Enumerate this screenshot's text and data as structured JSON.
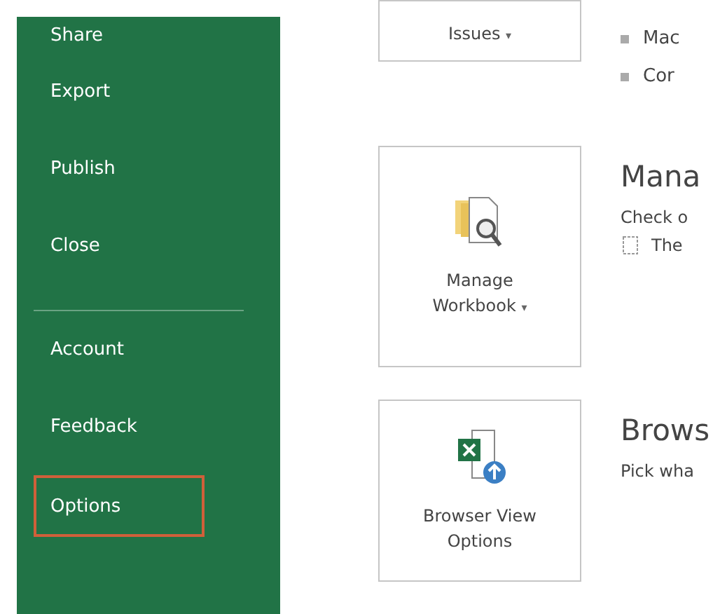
{
  "sidebar": {
    "items": [
      {
        "label": "Share",
        "selected": false,
        "divider_before": false
      },
      {
        "label": "Export",
        "selected": false,
        "divider_before": false
      },
      {
        "label": "Publish",
        "selected": false,
        "divider_before": false
      },
      {
        "label": "Close",
        "selected": false,
        "divider_before": false
      },
      {
        "label": "Account",
        "selected": false,
        "divider_before": true
      },
      {
        "label": "Feedback",
        "selected": false,
        "divider_before": false
      },
      {
        "label": "Options",
        "selected": true,
        "divider_before": false
      }
    ]
  },
  "sections": [
    {
      "kind": "issues",
      "button": "Issues",
      "caret": "▾",
      "bullets": [
        "Mac",
        "Cor"
      ]
    },
    {
      "kind": "manage",
      "button": [
        "Manage",
        "Workbook"
      ],
      "caret": "▾",
      "title": "Mana",
      "description": "Check o",
      "note": "The"
    },
    {
      "kind": "browser",
      "button": [
        "Browser View",
        "Options"
      ],
      "title": "Brows",
      "description": "Pick wha"
    }
  ]
}
